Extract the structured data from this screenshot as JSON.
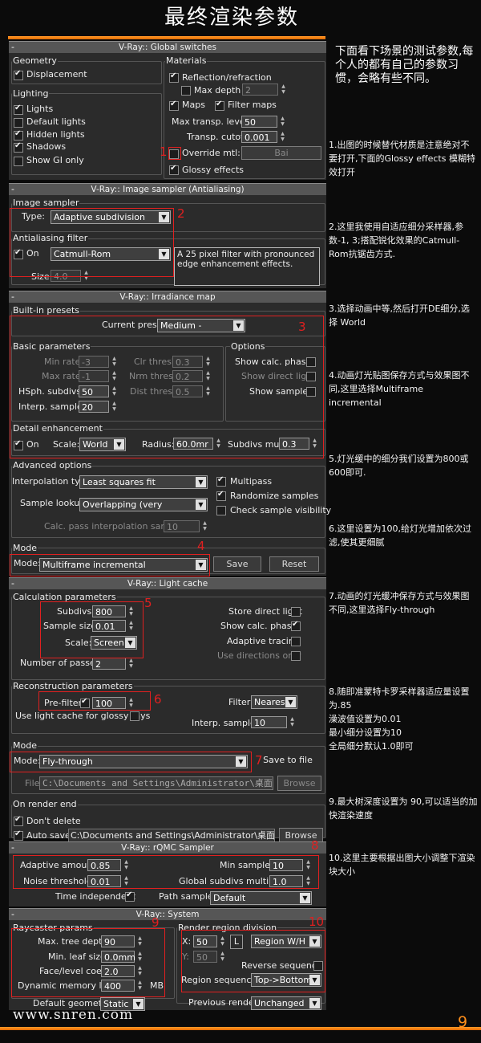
{
  "page_title": "最终渲染参数",
  "watermark": "www.snren.com",
  "page_number": "9",
  "intro_note": "下面看下场景的测试参数,每个人的都有自己的参数习惯，会略有些不同。",
  "notes": [
    "1.出图的时候替代材质是注意绝对不要打开,下面的Glossy effects 模糊特效打开",
    "2.这里我使用自适应细分采样器,参数-1, 3;搭配锐化效果的Catmull-Rom抗锯齿方式.",
    "3.选择动画中等,然后打开DE细分,选择 World",
    "4.动画灯光贴图保存方式与效果图不同,这里选择Multiframe incremental",
    "5.灯光缓中的细分我们设置为800或600即可.",
    "6.这里设置为100,给灯光增加依次过滤,使其更细腻",
    "7.动画的灯光缓冲保存方式与效果图不同,这里选择Fly-through",
    "8.随即准蒙特卡罗采样器适应量设置为.85\n澡波值设置为0.01\n最小细分设置为10\n全局细分默认1.0即可",
    "9.最大树深度设置为 90,可以适当的加快渲染速度",
    "10.这里主要根据出图大小调整下渲染块大小"
  ],
  "callouts": [
    "1",
    "2",
    "3",
    "4",
    "5",
    "6",
    "7",
    "8",
    "9",
    "10"
  ],
  "global_switches": {
    "rollout": "V-Ray:: Global switches",
    "geometry": "Geometry",
    "displacement": "Displacement",
    "lighting": "Lighting",
    "lights": "Lights",
    "default_lights": "Default lights",
    "hidden_lights": "Hidden lights",
    "shadows": "Shadows",
    "show_gi_only": "Show GI only",
    "materials": "Materials",
    "reflection": "Reflection/refraction",
    "max_depth": "Max depth",
    "max_depth_val": "2",
    "maps": "Maps",
    "filter_maps": "Filter maps",
    "max_transp": "Max transp. levels",
    "max_transp_val": "50",
    "transp_cutoff": "Transp. cutoff",
    "transp_cutoff_val": "0.001",
    "override_mtl": "Override mtl:",
    "override_btn": "Bai",
    "glossy": "Glossy effects"
  },
  "image_sampler": {
    "rollout": "V-Ray:: Image sampler (Antialiasing)",
    "group": "Image sampler",
    "type_label": "Type:",
    "type_val": "Adaptive subdivision",
    "aa_filter": "Antialiasing filter",
    "on": "On",
    "filter_val": "Catmull-Rom",
    "desc": "A 25 pixel filter with pronounced edge enhancement effects.",
    "size_label": "Size:",
    "size_val": "4.0"
  },
  "irradiance": {
    "rollout": "V-Ray:: Irradiance map",
    "presets": "Built-in presets",
    "current_preset": "Current preset:",
    "preset_val": "Medium - animation",
    "basic": "Basic parameters",
    "min_rate": "Min rate:",
    "min_rate_val": "-3",
    "max_rate": "Max rate:",
    "max_rate_val": "-1",
    "hsph": "HSph. subdivs:",
    "hsph_val": "50",
    "interp": "Interp. samples:",
    "interp_val": "20",
    "clr": "Clr thresh:",
    "clr_val": "0.3",
    "nrm": "Nrm thresh:",
    "nrm_val": "0.2",
    "dist": "Dist thresh:",
    "dist_val": "0.5",
    "options": "Options",
    "show_calc": "Show calc. phase",
    "show_direct": "Show direct light",
    "show_samples": "Show samples",
    "detail": "Detail enhancement",
    "on": "On",
    "scale": "Scale:",
    "scale_val": "World",
    "radius": "Radius:",
    "radius_val": "60.0mr",
    "subdivs_mult": "Subdivs mult.",
    "subdivs_mult_val": "0.3",
    "advanced": "Advanced options",
    "interp_type": "Interpolation type:",
    "interp_type_val": "Least squares fit (good/smooth",
    "sample_lookup": "Sample lookup:",
    "sample_lookup_val": "Overlapping (very good/fast)",
    "multipass": "Multipass",
    "randomize": "Randomize samples",
    "check_vis": "Check sample visibility",
    "calc_pass": "Calc. pass interpolation samples:",
    "calc_pass_val": "10",
    "mode_group": "Mode",
    "mode_label": "Mode:",
    "mode_val": "Multiframe incremental",
    "save": "Save",
    "reset": "Reset"
  },
  "light_cache": {
    "rollout": "V-Ray:: Light cache",
    "calc": "Calculation parameters",
    "subdivs": "Subdivs:",
    "subdivs_val": "800",
    "sample_size": "Sample size:",
    "sample_size_val": "0.01",
    "scale": "Scale:",
    "scale_val": "Screen",
    "passes": "Number of passes:",
    "passes_val": "2",
    "store_direct": "Store direct light",
    "show_calc": "Show calc. phase",
    "adaptive": "Adaptive tracing",
    "use_dirs": "Use directions only",
    "recon": "Reconstruction parameters",
    "prefilter": "Pre-filter:",
    "prefilter_val": "100",
    "use_glossy": "Use light cache for glossy rays",
    "filter": "Filter:",
    "filter_val": "Nearest",
    "interp": "Interp. samples:",
    "interp_val": "10",
    "mode_group": "Mode",
    "mode_label": "Mode:",
    "mode_val": "Fly-through",
    "save_file": "Save to file",
    "file_label": "File:",
    "file_val": "C:\\Documents and Settings\\Administrator\\桌面",
    "browse": "Browse",
    "on_end": "On render end",
    "dont_delete": "Don't delete",
    "autosave": "Auto save:",
    "autosave_val": "C:\\Documents and Settings\\Administrator\\桌面",
    "browse2": "Browse"
  },
  "rqmc": {
    "rollout": "V-Ray:: rQMC Sampler",
    "adaptive": "Adaptive amount:",
    "adaptive_val": "0.85",
    "noise": "Noise threshold:",
    "noise_val": "0.01",
    "min_samples": "Min samples:",
    "min_samples_val": "10",
    "global_mult": "Global subdivs multiplier:",
    "global_mult_val": "1.0",
    "time_indep": "Time independent",
    "path_sampler": "Path sampler:",
    "path_val": "Default"
  },
  "system": {
    "rollout": "V-Ray:: System",
    "raycaster": "Raycaster params",
    "max_tree": "Max. tree depth:",
    "max_tree_val": "90",
    "min_leaf": "Min. leaf size:",
    "min_leaf_val": "0.0mm",
    "face_level": "Face/level coef.",
    "face_level_val": "2.0",
    "dyn_mem": "Dynamic memory limit:",
    "dyn_mem_val": "400",
    "mb": "MB",
    "default_geo": "Default geometry:",
    "default_geo_val": "Static",
    "region": "Render region division",
    "x": "X:",
    "x_val": "50",
    "y": "Y:",
    "y_val": "50",
    "l": "L",
    "region_wh": "Region W/H",
    "reverse": "Reverse sequence",
    "region_seq": "Region sequence:",
    "region_seq_val": "Top->Bottom",
    "prev": "Previous render:",
    "prev_val": "Unchanged"
  }
}
